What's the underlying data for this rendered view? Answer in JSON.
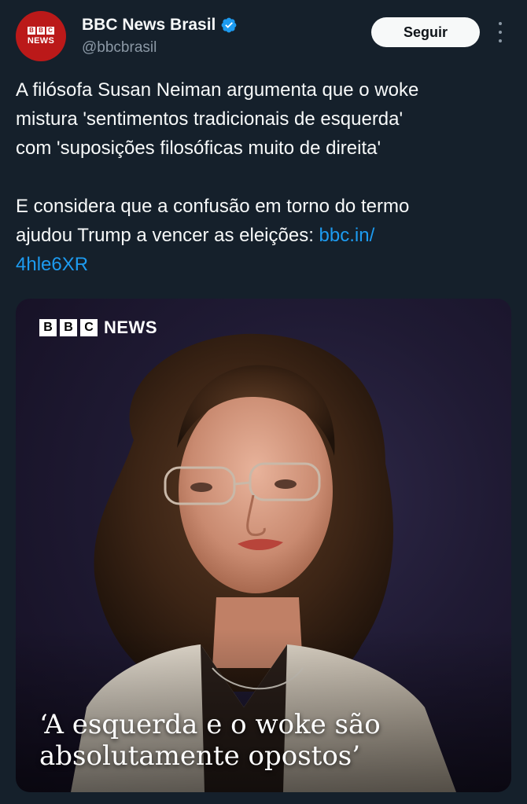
{
  "account": {
    "name": "BBC News Brasil",
    "handle": "@bbcbrasil",
    "avatar_text": "NEWS",
    "avatar_blocks": [
      "B",
      "B",
      "C"
    ],
    "verified_icon": "verified-badge-icon",
    "follow_label": "Seguir",
    "more_icon": "more-options-icon"
  },
  "tweet": {
    "lines": [
      "A filósofa Susan Neiman argumenta que o woke",
      "mistura 'sentimentos tradicionais de esquerda'",
      "com 'suposições filosóficas muito de direita'"
    ],
    "lines2": [
      "E considera que a confusão em torno do termo",
      "ajudou Trump a vencer as eleições: "
    ],
    "link_part1": "bbc.in/",
    "link_part2": "4hle6XR"
  },
  "media": {
    "logo_blocks": [
      "B",
      "B",
      "C"
    ],
    "logo_text": "NEWS",
    "quote_line1": "‘A esquerda e o woke são",
    "quote_line2": "absolutamente opostos’"
  },
  "colors": {
    "background": "#15202b",
    "link": "#1d9bf0",
    "bbc_red": "#bb1919",
    "verified": "#1d9bf0"
  }
}
